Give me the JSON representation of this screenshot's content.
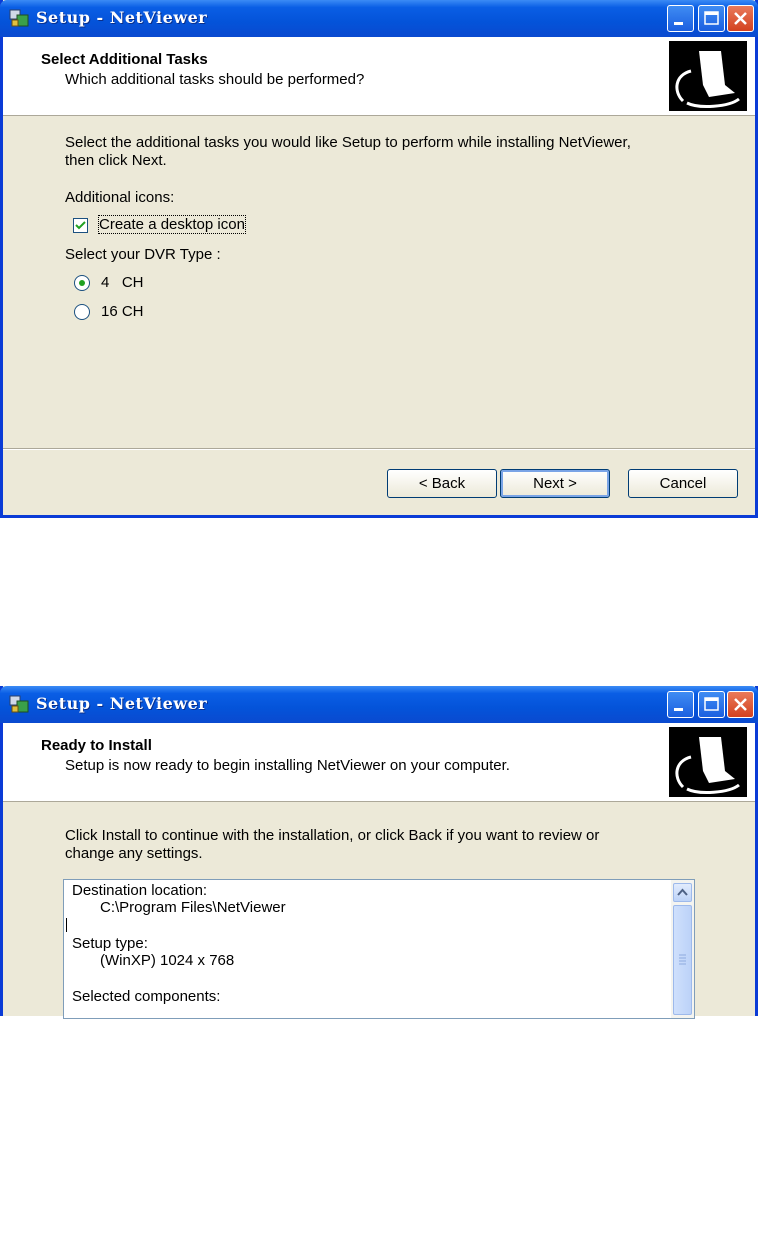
{
  "window1": {
    "title": "Setup - NetViewer",
    "header_title": "Select Additional Tasks",
    "header_subtitle": "Which additional tasks should be performed?",
    "intro_line1": "Select the additional tasks you would like Setup to perform while installing NetViewer,",
    "intro_line2": "then click Next.",
    "icons_label": "Additional icons:",
    "desktop_checkbox": {
      "label": "Create a desktop icon",
      "checked": true
    },
    "dvr_label": "Select your DVR Type :",
    "dvr_options": [
      {
        "label": "4   CH",
        "selected": true
      },
      {
        "label": "16 CH",
        "selected": false
      }
    ],
    "buttons": {
      "back": "< Back",
      "next": "Next >",
      "cancel": "Cancel"
    }
  },
  "window2": {
    "title": "Setup - NetViewer",
    "header_title": "Ready to Install",
    "header_subtitle": "Setup is now ready to begin installing NetViewer on your computer.",
    "intro_line1": "Click Install to continue with the installation, or click Back if you want to review or",
    "intro_line2": "change any settings.",
    "summary": {
      "dest_label": "Destination location:",
      "dest_value": "C:\\Program Files\\NetViewer",
      "type_label": "Setup type:",
      "type_value": "(WinXP) 1024 x 768",
      "components_label": "Selected components:"
    }
  },
  "colors": {
    "titlebar": "#0453d9",
    "dialog_bg": "#ece9d8",
    "close_button": "#d3411f",
    "radio_dot": "#21a121"
  }
}
